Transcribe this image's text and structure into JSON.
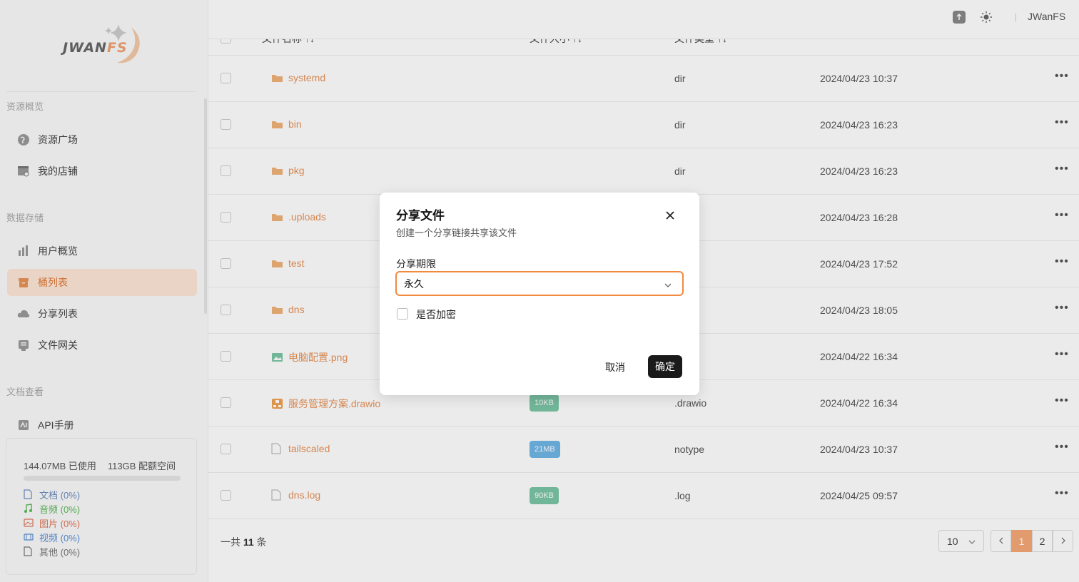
{
  "app": {
    "logo_text_a": "JWAN",
    "logo_text_b": "FS"
  },
  "sidebar": {
    "sections": [
      {
        "title": "资源概览"
      },
      {
        "title": "数据存储"
      },
      {
        "title": "文档查看"
      }
    ],
    "items": [
      {
        "label": "资源广场",
        "icon": "globe-icon"
      },
      {
        "label": "我的店铺",
        "icon": "store-icon"
      },
      {
        "label": "用户概览",
        "icon": "bar-chart-icon"
      },
      {
        "label": "桶列表",
        "icon": "bucket-icon",
        "active": true
      },
      {
        "label": "分享列表",
        "icon": "cloud-share-icon"
      },
      {
        "label": "文件网关",
        "icon": "gateway-icon"
      },
      {
        "label": "API手册",
        "icon": "api-book-icon"
      }
    ],
    "storage": {
      "used": "144.07MB 已使用",
      "quota": "113GB 配额空间",
      "usage_fraction": 0.0,
      "categories": [
        {
          "label": "文档 (0%)",
          "color": "#6c8ebf",
          "icon": "document-icon"
        },
        {
          "label": "音频 (0%)",
          "color": "#5cb85c",
          "icon": "music-icon"
        },
        {
          "label": "图片 (0%)",
          "color": "#e0765a",
          "icon": "image-icon"
        },
        {
          "label": "视频 (0%)",
          "color": "#5b8fd6",
          "icon": "video-icon"
        },
        {
          "label": "其他 (0%)",
          "color": "#777777",
          "icon": "file-icon"
        }
      ]
    }
  },
  "header": {
    "username": "JWanFS"
  },
  "table": {
    "columns": [
      "文件名称",
      "文件大小",
      "文件类型"
    ],
    "rows": [
      {
        "name": "systemd",
        "kind": "folder",
        "size": "",
        "type": "dir",
        "time": "2024/04/23 10:37"
      },
      {
        "name": "bin",
        "kind": "folder",
        "size": "",
        "type": "dir",
        "time": "2024/04/23 16:23"
      },
      {
        "name": "pkg",
        "kind": "folder",
        "size": "",
        "type": "dir",
        "time": "2024/04/23 16:23"
      },
      {
        "name": ".uploads",
        "kind": "folder",
        "size": "",
        "type": "",
        "time": "2024/04/23 16:28"
      },
      {
        "name": "test",
        "kind": "folder",
        "size": "",
        "type": "",
        "time": "2024/04/23 17:52"
      },
      {
        "name": "dns",
        "kind": "folder",
        "size": "",
        "type": "",
        "time": "2024/04/23 18:05"
      },
      {
        "name": "电脑配置.png",
        "kind": "image",
        "size": "",
        "type": "",
        "time": "2024/04/22 16:34"
      },
      {
        "name": "服务管理方案.drawio",
        "kind": "drawio",
        "size": "10KB",
        "size_color": "#7cc6a6",
        "type": ".drawio",
        "time": "2024/04/22 16:34"
      },
      {
        "name": "tailscaled",
        "kind": "file",
        "size": "21MB",
        "size_color": "#6fb6e6",
        "type": "notype",
        "time": "2024/04/23 10:37"
      },
      {
        "name": "dns.log",
        "kind": "file",
        "size": "90KB",
        "size_color": "#7cc6a6",
        "type": ".log",
        "time": "2024/04/25 09:57"
      }
    ]
  },
  "pagination": {
    "total_prefix": "一共",
    "total_count": "11",
    "total_suffix": "条",
    "page_size": "10",
    "pages": [
      "1",
      "2"
    ],
    "current": "1"
  },
  "modal": {
    "title": "分享文件",
    "subtitle": "创建一个分享链接共享该文件",
    "expiry_label": "分享期限",
    "expiry_value": "永久",
    "encrypt_label": "是否加密",
    "encrypt_checked": false,
    "cancel_label": "取消",
    "ok_label": "确定"
  },
  "colors": {
    "accent": "#f08a3e",
    "file_name": "#e8935a",
    "primary_button": "#1a1a1a"
  }
}
